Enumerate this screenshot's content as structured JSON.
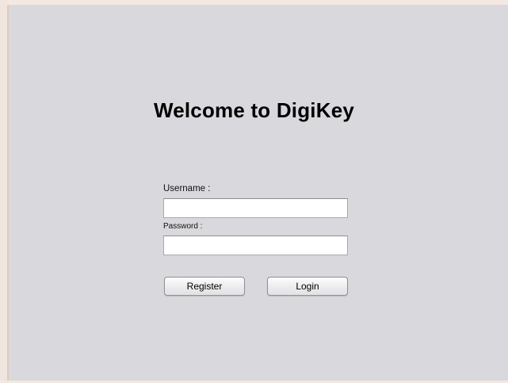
{
  "login": {
    "title": "Welcome to DigiKey",
    "username_label": "Username :",
    "password_label": "Password :",
    "username_value": "",
    "password_value": "",
    "register_label": "Register",
    "login_label": "Login"
  }
}
